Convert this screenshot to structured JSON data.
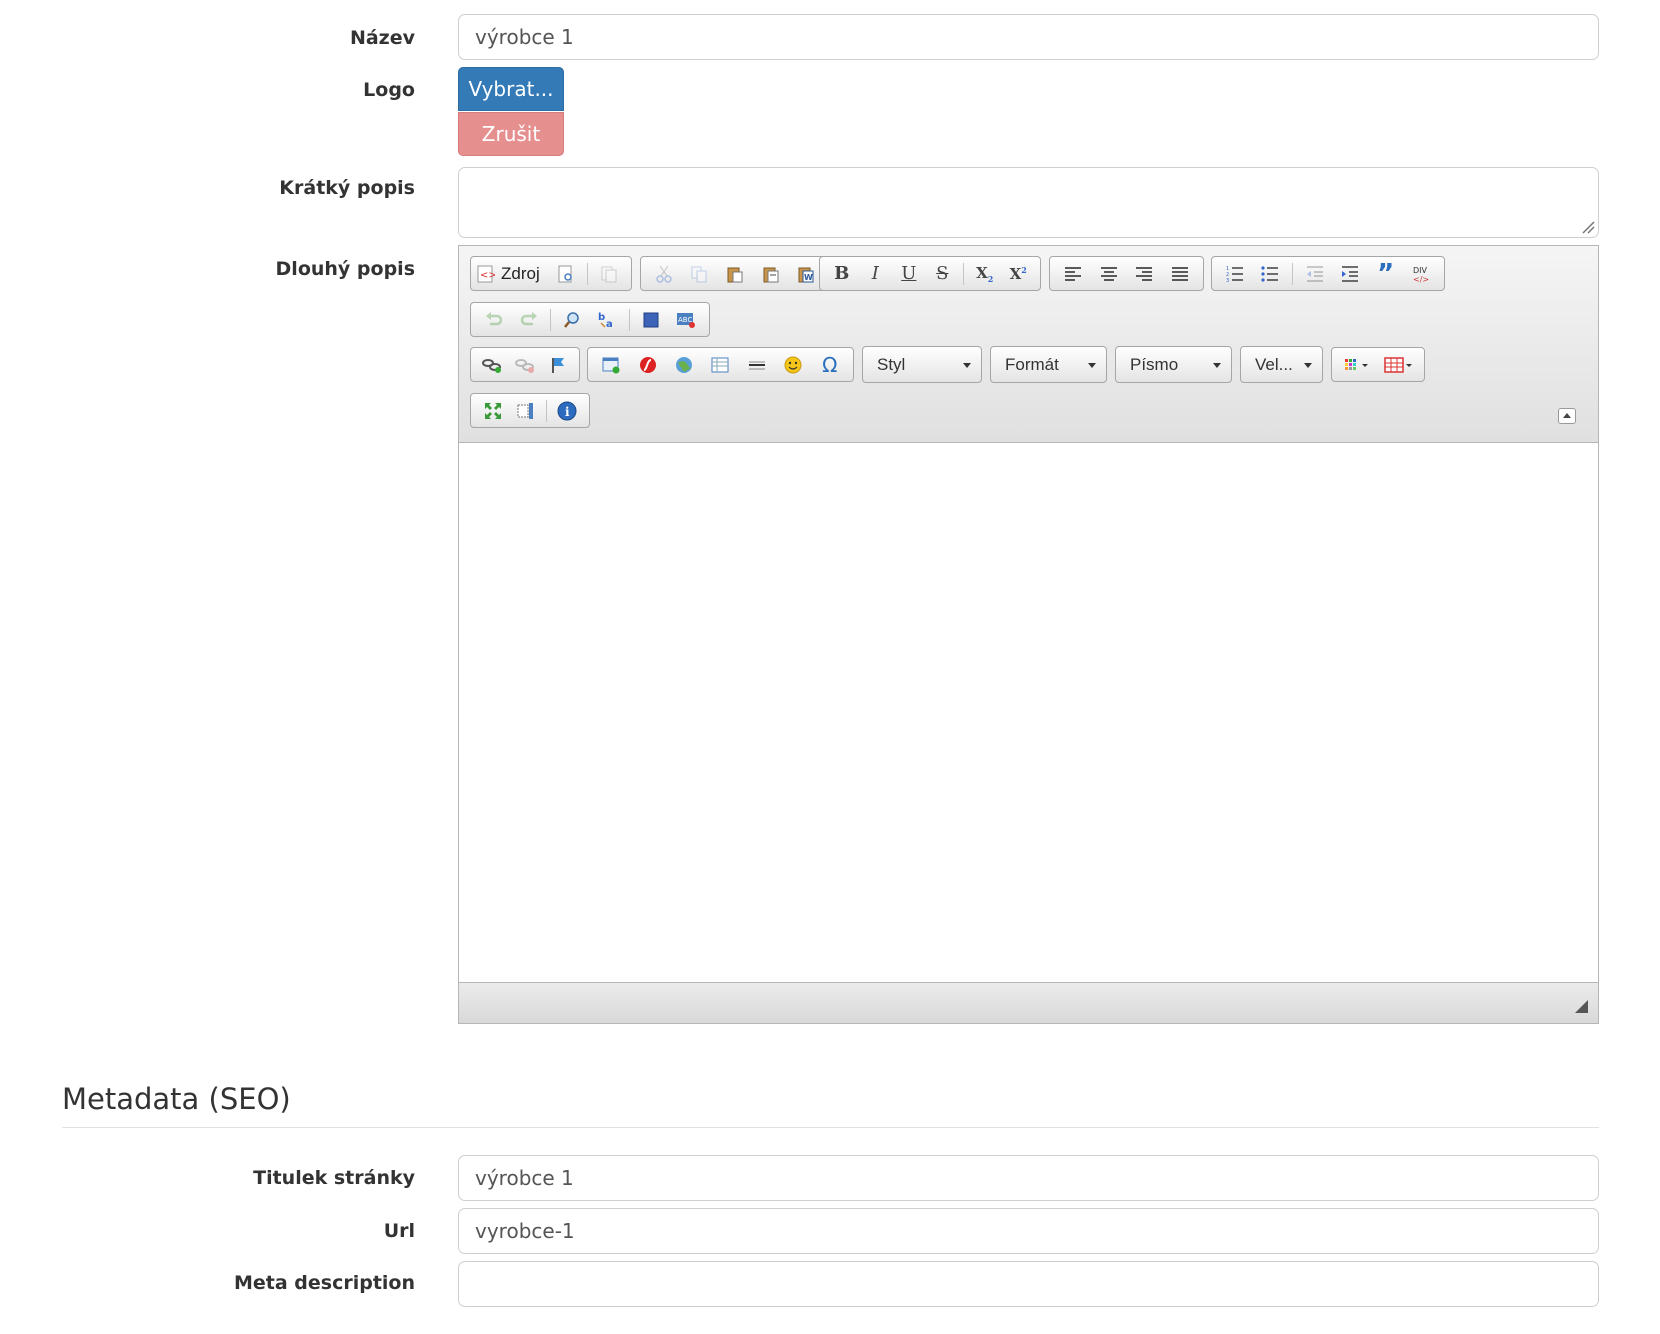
{
  "form": {
    "name": {
      "label": "Název",
      "value": "výrobce 1"
    },
    "logo": {
      "label": "Logo",
      "select_label": "Vybrat...",
      "cancel_label": "Zrušit"
    },
    "short_desc": {
      "label": "Krátký popis",
      "value": ""
    },
    "long_desc": {
      "label": "Dlouhý popis"
    }
  },
  "editor": {
    "source_label": "Zdroj",
    "combos": {
      "style": "Styl",
      "format": "Formát",
      "font": "Písmo",
      "size": "Vel..."
    },
    "toolbar_icons": [
      "source-icon",
      "preview-icon",
      "templates-icon",
      "cut-icon",
      "copy-icon",
      "paste-icon",
      "paste-text-icon",
      "paste-word-icon",
      "bold-icon",
      "italic-icon",
      "underline-icon",
      "strike-icon",
      "subscript-icon",
      "superscript-icon",
      "align-left-icon",
      "align-center-icon",
      "align-right-icon",
      "align-justify-icon",
      "numbered-list-icon",
      "bulleted-list-icon",
      "outdent-icon",
      "indent-icon",
      "blockquote-icon",
      "div-icon",
      "undo-icon",
      "redo-icon",
      "find-icon",
      "replace-icon",
      "select-all-icon",
      "spellcheck-icon",
      "link-icon",
      "unlink-icon",
      "anchor-icon",
      "image-icon",
      "flash-icon",
      "iframe-icon",
      "table-icon",
      "horizontal-line-icon",
      "smiley-icon",
      "special-char-icon",
      "text-color-icon",
      "table-grid-icon",
      "maximize-icon",
      "show-blocks-icon",
      "about-icon"
    ]
  },
  "seo": {
    "heading": "Metadata (SEO)",
    "title": {
      "label": "Titulek stránky",
      "value": "výrobce 1"
    },
    "url": {
      "label": "Url",
      "value": "vyrobce-1"
    },
    "meta_description": {
      "label": "Meta description",
      "value": ""
    }
  }
}
